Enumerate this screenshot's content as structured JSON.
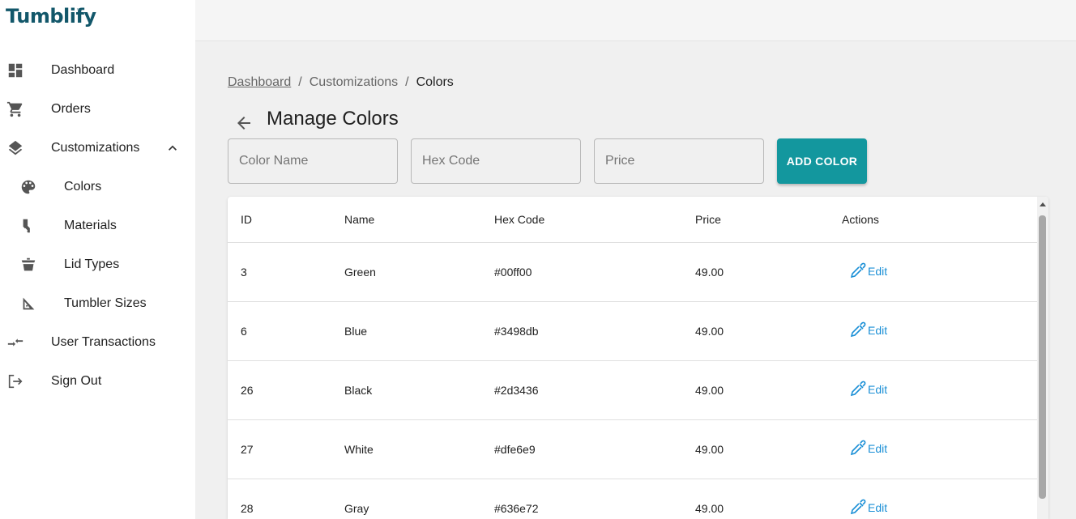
{
  "app": {
    "logo": "Tumblify",
    "logo_mark": "™"
  },
  "sidebar": {
    "items": [
      {
        "label": "Dashboard",
        "icon": "dashboard-icon"
      },
      {
        "label": "Orders",
        "icon": "cart-icon"
      },
      {
        "label": "Customizations",
        "icon": "layers-icon",
        "expanded": true
      },
      {
        "label": "Colors",
        "icon": "palette-icon"
      },
      {
        "label": "Materials",
        "icon": "brush-icon"
      },
      {
        "label": "Lid Types",
        "icon": "lid-icon"
      },
      {
        "label": "Tumbler Sizes",
        "icon": "ruler-icon"
      },
      {
        "label": "User Transactions",
        "icon": "transactions-icon"
      },
      {
        "label": "Sign Out",
        "icon": "logout-icon"
      }
    ]
  },
  "breadcrumb": {
    "link": "Dashboard",
    "middle": "Customizations",
    "current": "Colors",
    "separator": "/"
  },
  "page": {
    "title": "Manage Colors"
  },
  "form": {
    "color_name_placeholder": "Color Name",
    "hex_code_placeholder": "Hex Code",
    "price_placeholder": "Price",
    "add_label": "ADD COLOR"
  },
  "table": {
    "headers": [
      "ID",
      "Name",
      "Hex Code",
      "Price",
      "Actions"
    ],
    "rows": [
      {
        "id": "3",
        "name": "Green",
        "hex": "#00ff00",
        "price": "49.00",
        "action": "Edit"
      },
      {
        "id": "6",
        "name": "Blue",
        "hex": "#3498db",
        "price": "49.00",
        "action": "Edit"
      },
      {
        "id": "26",
        "name": "Black",
        "hex": "#2d3436",
        "price": "49.00",
        "action": "Edit"
      },
      {
        "id": "27",
        "name": "White",
        "hex": "#dfe6e9",
        "price": "49.00",
        "action": "Edit"
      },
      {
        "id": "28",
        "name": "Gray",
        "hex": "#636e72",
        "price": "49.00",
        "action": "Edit"
      }
    ]
  },
  "colors": {
    "brand": "#12576a",
    "accent": "#13979e",
    "link": "#1a8fd6"
  }
}
